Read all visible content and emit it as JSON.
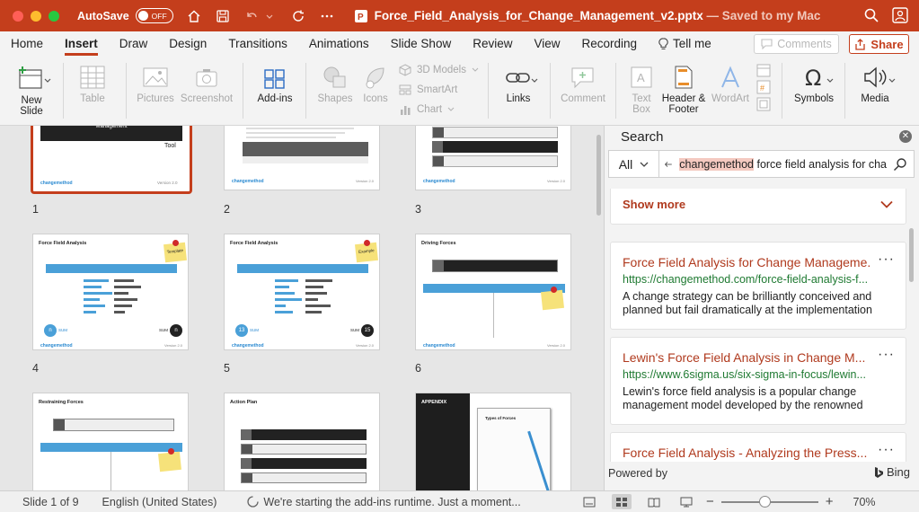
{
  "titlebar": {
    "autosave_label": "AutoSave",
    "autosave_state": "OFF",
    "doc_name": "Force_Field_Analysis_for_Change_Management_v2.pptx",
    "saved_status": "— Saved to my Mac",
    "accent": "#c43e1c"
  },
  "tabs": [
    "Home",
    "Insert",
    "Draw",
    "Design",
    "Transitions",
    "Animations",
    "Slide Show",
    "Review",
    "View",
    "Recording",
    "Tell me"
  ],
  "active_tab": "Insert",
  "comments_label": "Comments",
  "share_label": "Share",
  "ribbon": {
    "new_slide": [
      "New",
      "Slide"
    ],
    "table": "Table",
    "pictures": "Pictures",
    "screenshot": "Screenshot",
    "addins": "Add-ins",
    "shapes": "Shapes",
    "icons": "Icons",
    "models3d": "3D Models",
    "smartart": "SmartArt",
    "chart": "Chart",
    "links": "Links",
    "comment": "Comment",
    "textbox": [
      "Text",
      "Box"
    ],
    "header_footer": [
      "Header &",
      "Footer"
    ],
    "wordart": "WordArt",
    "symbols": "Symbols",
    "media": "Media"
  },
  "slides": [
    {
      "num": "1",
      "title": "",
      "subtitle": "Tool",
      "footer": "Version 2.0",
      "band": "Management"
    },
    {
      "num": "2",
      "title": "",
      "footer": "Version 2.0"
    },
    {
      "num": "3",
      "title": "",
      "footer": "Version 2.0"
    },
    {
      "num": "4",
      "title": "Force Field Analysis",
      "sticky": "Template",
      "sum_label": "SUM",
      "left_badge": "n",
      "right_badge": "n",
      "footer": "Version 2.0"
    },
    {
      "num": "5",
      "title": "Force Field Analysis",
      "sticky": "Example",
      "sum_label": "SUM",
      "left_badge": "13",
      "right_badge": "15",
      "footer": "Version 2.0"
    },
    {
      "num": "6",
      "title": "Driving Forces",
      "footer": "Version 2.0"
    },
    {
      "num": "",
      "title": "Restraining Forces"
    },
    {
      "num": "",
      "title": "Action Plan"
    },
    {
      "num": "",
      "title": "APPENDIX",
      "sub": "Types of Forces"
    }
  ],
  "logo_text": "changemethod",
  "search": {
    "pane_title": "Search",
    "scope": "All",
    "query_highlight": "changemethod",
    "query_rest": " force field analysis for cha",
    "show_more": "Show more",
    "results": [
      {
        "title": "Force Field Analysis for Change Manageme...",
        "url": "https://changemethod.com/force-field-analysis-f...",
        "snippet": "A change strategy can be brilliantly conceived and planned but fail dramatically at the implementation"
      },
      {
        "title": "Lewin's Force Field Analysis in Change M...",
        "url": "https://www.6sigma.us/six-sigma-in-focus/lewin...",
        "snippet": "Lewin's force field analysis is a popular change management model developed by the renowned"
      },
      {
        "title": "Force Field Analysis - Analyzing the Press...",
        "url": "",
        "snippet": ""
      }
    ],
    "powered_by": "Powered by",
    "bing": "Bing"
  },
  "status": {
    "slide": "Slide 1 of 9",
    "language": "English (United States)",
    "message": "We're starting the add-ins runtime. Just a moment...",
    "zoom": "70%",
    "zoom_level": 0.45
  }
}
